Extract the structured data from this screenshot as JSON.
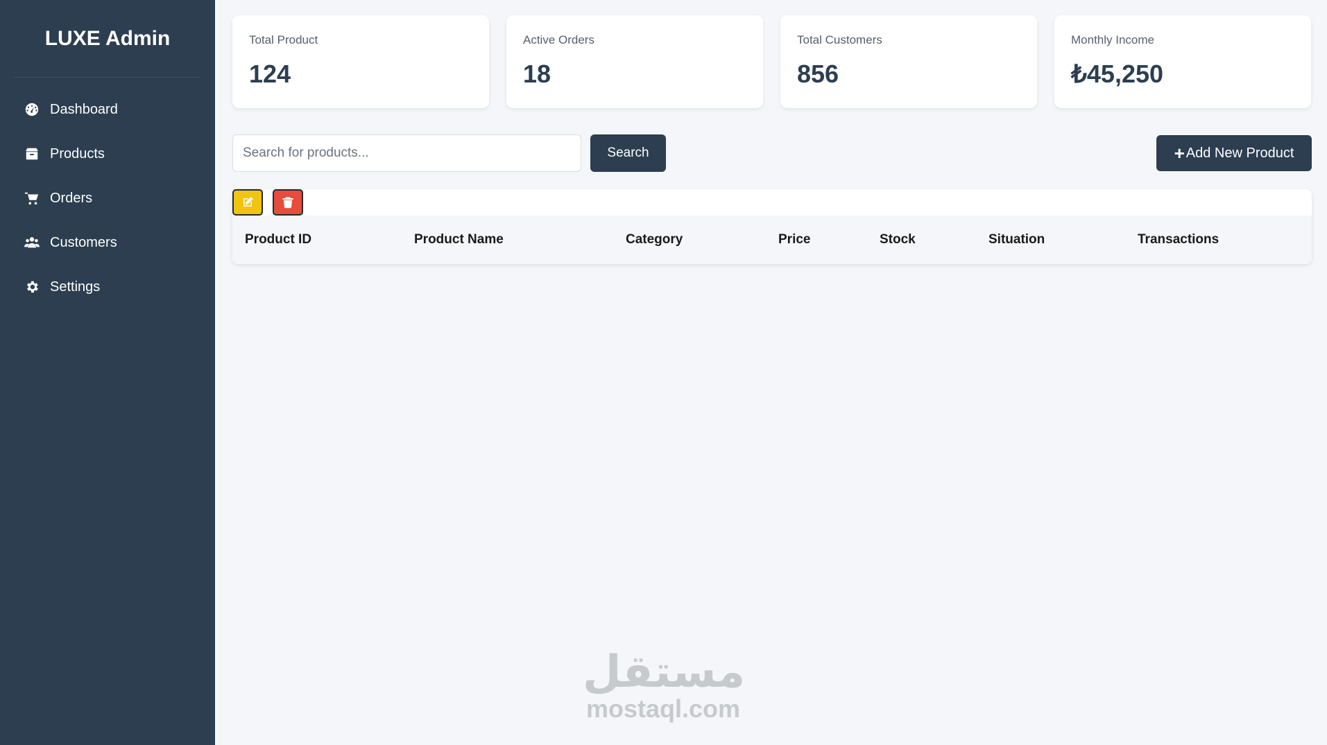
{
  "sidebar": {
    "brand": "LUXE Admin",
    "items": [
      {
        "label": "Dashboard",
        "icon": "dashboard-gauge-icon"
      },
      {
        "label": "Products",
        "icon": "box-icon"
      },
      {
        "label": "Orders",
        "icon": "cart-icon"
      },
      {
        "label": "Customers",
        "icon": "users-icon"
      },
      {
        "label": "Settings",
        "icon": "gear-icon"
      }
    ]
  },
  "stats": [
    {
      "label": "Total Product",
      "value": "124"
    },
    {
      "label": "Active Orders",
      "value": "18"
    },
    {
      "label": "Total Customers",
      "value": "856"
    },
    {
      "label": "Monthly Income",
      "value": "₺45,250"
    }
  ],
  "toolbar": {
    "search_placeholder": "Search for products...",
    "search_label": "Search",
    "add_label": "Add New Product",
    "add_icon": "plus-icon"
  },
  "table": {
    "columns": [
      "Product ID",
      "Product Name",
      "Category",
      "Price",
      "Stock",
      "Situation",
      "Transactions"
    ],
    "edit_icon": "edit-icon",
    "delete_icon": "trash-icon"
  },
  "watermark": {
    "arabic": "مستقل",
    "latin": "mostaql.com"
  },
  "colors": {
    "sidebar": "#2c3e50",
    "background": "#f4f6f9",
    "edit": "#f1c40f",
    "delete": "#e74c3c"
  }
}
